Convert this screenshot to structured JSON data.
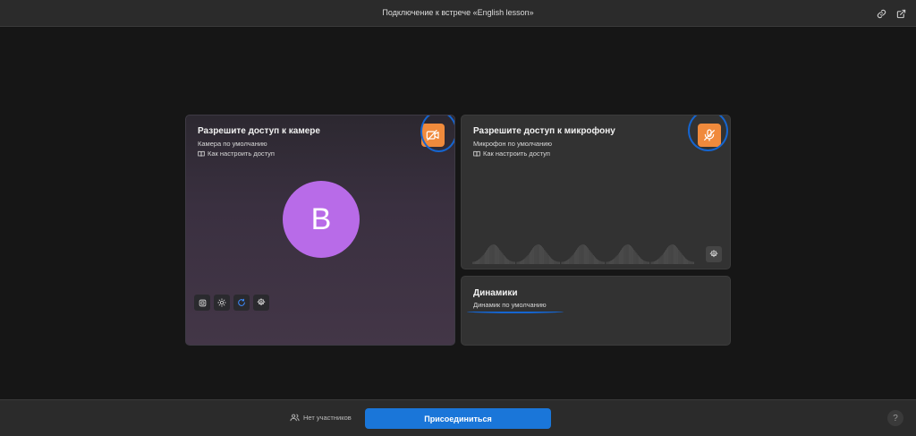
{
  "header": {
    "title": "Подключение к встрече «English lesson»",
    "icons": [
      "link-icon",
      "external-link-icon"
    ]
  },
  "camera": {
    "title": "Разрешите доступ к камере",
    "device": "Камера по умолчанию",
    "help_link": "Как настроить доступ",
    "avatar_letter": "B",
    "tools": [
      "grid-icon",
      "brightness-icon",
      "flip-icon",
      "settings-icon"
    ]
  },
  "microphone": {
    "title": "Разрешите доступ к микрофону",
    "device": "Микрофон по умолчанию",
    "help_link": "Как настроить доступ"
  },
  "speakers": {
    "title": "Динамики",
    "device": "Динамик по умолчанию"
  },
  "footer": {
    "participants": "Нет участников",
    "join_label": "Присоединиться",
    "help_label": "?"
  },
  "colors": {
    "accent_orange": "#f08a3c",
    "primary_blue": "#1a76d9",
    "annotation_blue": "#1565d0",
    "avatar": "#b86be8"
  }
}
